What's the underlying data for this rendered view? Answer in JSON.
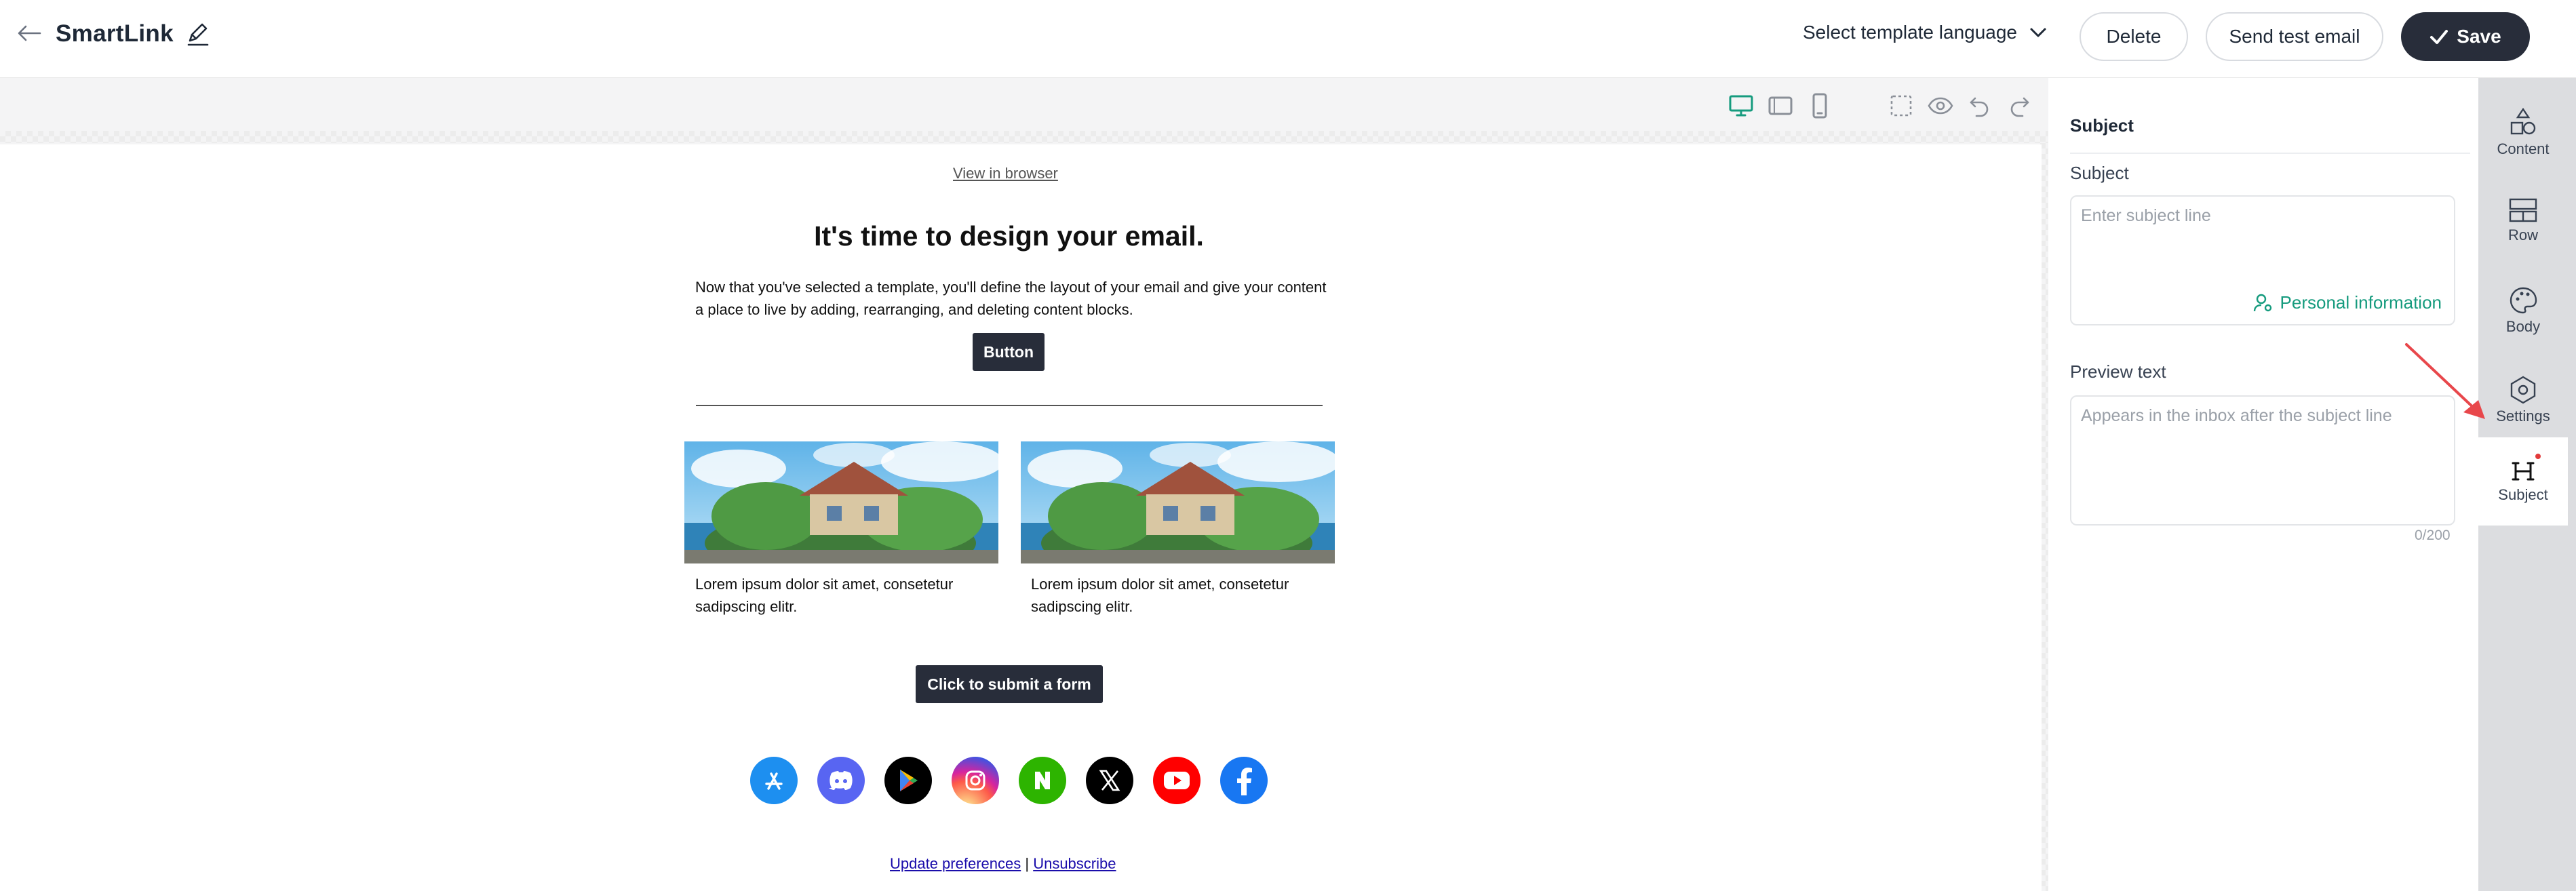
{
  "header": {
    "title": "SmartLink",
    "language_label": "Select template language",
    "delete_label": "Delete",
    "send_test_label": "Send test email",
    "save_label": "Save"
  },
  "email": {
    "view_in_browser": "View in browser",
    "headline": "It's time to design your email.",
    "intro": "Now that you've selected a template, you'll define the layout of your email and give your content a place to live by adding, rearranging, and deleting content blocks.",
    "button_label": "Button",
    "columns": [
      {
        "caption": "Lorem ipsum dolor sit amet, consetetur sadipscing elitr."
      },
      {
        "caption": "Lorem ipsum dolor sit amet, consetetur sadipscing elitr."
      }
    ],
    "form_button_label": "Click to submit a form",
    "social_icons": [
      "app-store-icon",
      "discord-icon",
      "google-play-icon",
      "instagram-icon",
      "naver-icon",
      "x-icon",
      "youtube-icon",
      "facebook-icon"
    ],
    "footer": {
      "update_preferences": "Update preferences",
      "separator": "|",
      "unsubscribe": "Unsubscribe"
    }
  },
  "settings_panel": {
    "title": "Subject",
    "subject_label": "Subject",
    "subject_placeholder": "Enter subject line",
    "personal_info_label": "Personal information",
    "preview_label": "Preview text",
    "preview_placeholder": "Appears in the inbox after the subject line",
    "preview_counter": "0/200"
  },
  "side_rail": {
    "items": [
      {
        "label": "Content",
        "icon": "shapes-icon"
      },
      {
        "label": "Row",
        "icon": "rows-icon"
      },
      {
        "label": "Body",
        "icon": "palette-icon"
      },
      {
        "label": "Settings",
        "icon": "hexagon-settings-icon"
      },
      {
        "label": "Subject",
        "icon": "heading-icon",
        "active": true
      }
    ]
  },
  "colors": {
    "primary_dark": "#282d3a",
    "accent_green": "#169b7e",
    "active_device": "#169b7e",
    "annotation_red": "#e8474b"
  }
}
